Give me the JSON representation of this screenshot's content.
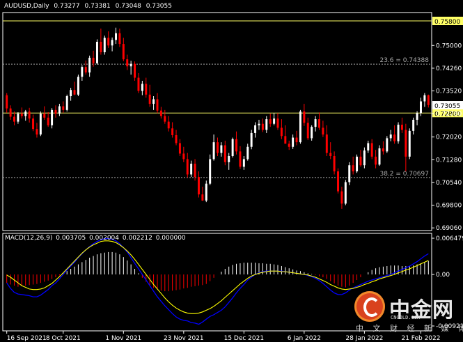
{
  "header": {
    "symbol": "AUDUSD,Daily",
    "open": "0.73277",
    "high": "0.73381",
    "low": "0.73048",
    "close": "0.73055"
  },
  "macd_header": {
    "label": "MACD(12,26,9)",
    "v1": "0.003705",
    "v2": "0.002004",
    "v3": "0.002212",
    "v4": "0.000000"
  },
  "watermark": {
    "brand": "中金网",
    "url": "CNGOLD.COM",
    "tagline": "中 文 财 经 新 媒 体"
  },
  "colors": {
    "background": "#000000",
    "up": "#ffffff",
    "down": "#ff0000",
    "line_level": "#ffff66",
    "fib_level": "#aaaaaa",
    "macd_line": "#0000ff",
    "signal_line": "#ffff00",
    "axis": "#ffffff"
  },
  "chart_data": [
    {
      "type": "candlestick",
      "title": "AUDUSD,Daily",
      "ylim": [
        0.69064,
        0.758
      ],
      "y_ticks": [
        "0.75000",
        "0.74260",
        "0.73520",
        "0.72780",
        "0.72020",
        "0.71280",
        "0.70540",
        "0.69800",
        "0.69060"
      ],
      "x_ticks": [
        "16 Sep 2021",
        "8 Oct 2021",
        "1 Nov 2021",
        "23 Nov 2021",
        "15 Dec 2021",
        "6 Jan 2022",
        "28 Jan 2022",
        "21 Feb 2022"
      ],
      "levels": [
        {
          "value": 0.758,
          "label": "0.75800",
          "kind": "line"
        },
        {
          "value": 0.7439,
          "label": "23.6 = 0.74388",
          "kind": "fib"
        },
        {
          "value": 0.728,
          "label": "0.72800",
          "kind": "line"
        },
        {
          "value": 0.707,
          "label": "38.2 = 0.70697",
          "kind": "fib"
        }
      ],
      "last_price": {
        "value": 0.73055,
        "label": "0.73055"
      },
      "ohlc": [
        [
          0.7338,
          0.7345,
          0.7281,
          0.7295
        ],
        [
          0.7295,
          0.7305,
          0.7258,
          0.7268
        ],
        [
          0.7268,
          0.7285,
          0.724,
          0.7252
        ],
        [
          0.7252,
          0.7283,
          0.7245,
          0.7278
        ],
        [
          0.7278,
          0.7298,
          0.7262,
          0.727
        ],
        [
          0.727,
          0.729,
          0.7255,
          0.7285
        ],
        [
          0.7285,
          0.7297,
          0.7249,
          0.7262
        ],
        [
          0.7262,
          0.7275,
          0.7221,
          0.7228
        ],
        [
          0.7228,
          0.7248,
          0.72,
          0.721
        ],
        [
          0.721,
          0.7285,
          0.7205,
          0.7278
        ],
        [
          0.7278,
          0.7302,
          0.7258,
          0.7265
        ],
        [
          0.7265,
          0.7283,
          0.7235,
          0.724
        ],
        [
          0.724,
          0.7296,
          0.723,
          0.729
        ],
        [
          0.729,
          0.7305,
          0.7265,
          0.7278
        ],
        [
          0.7278,
          0.731,
          0.727,
          0.7302
        ],
        [
          0.7302,
          0.7318,
          0.7281,
          0.729
        ],
        [
          0.729,
          0.734,
          0.7285,
          0.7335
        ],
        [
          0.7335,
          0.7362,
          0.732,
          0.7355
        ],
        [
          0.7355,
          0.7382,
          0.7338,
          0.734
        ],
        [
          0.734,
          0.7405,
          0.7335,
          0.7398
        ],
        [
          0.7398,
          0.7436,
          0.7385,
          0.743
        ],
        [
          0.743,
          0.7451,
          0.7405,
          0.7412
        ],
        [
          0.7412,
          0.7467,
          0.7398,
          0.746
        ],
        [
          0.746,
          0.7483,
          0.7431,
          0.7442
        ],
        [
          0.7442,
          0.752,
          0.7438,
          0.7512
        ],
        [
          0.7512,
          0.7555,
          0.747,
          0.7478
        ],
        [
          0.7478,
          0.7532,
          0.747,
          0.7525
        ],
        [
          0.7525,
          0.7546,
          0.7492,
          0.75
        ],
        [
          0.75,
          0.7526,
          0.7481,
          0.7518
        ],
        [
          0.7518,
          0.7558,
          0.7505,
          0.754
        ],
        [
          0.754,
          0.7555,
          0.7495,
          0.7505
        ],
        [
          0.7505,
          0.7525,
          0.7449,
          0.7455
        ],
        [
          0.7455,
          0.747,
          0.742,
          0.7432
        ],
        [
          0.7432,
          0.745,
          0.7405,
          0.744
        ],
        [
          0.744,
          0.7448,
          0.7385,
          0.7395
        ],
        [
          0.7395,
          0.741,
          0.7345,
          0.7352
        ],
        [
          0.7352,
          0.7385,
          0.7338,
          0.7375
        ],
        [
          0.7375,
          0.7395,
          0.733,
          0.734
        ],
        [
          0.734,
          0.7372,
          0.73,
          0.731
        ],
        [
          0.731,
          0.7335,
          0.729,
          0.7325
        ],
        [
          0.7325,
          0.7345,
          0.728,
          0.7288
        ],
        [
          0.7288,
          0.73,
          0.7262,
          0.727
        ],
        [
          0.727,
          0.729,
          0.7245,
          0.7252
        ],
        [
          0.7252,
          0.727,
          0.722,
          0.723
        ],
        [
          0.723,
          0.725,
          0.72,
          0.7208
        ],
        [
          0.7208,
          0.7225,
          0.7175,
          0.7182
        ],
        [
          0.7182,
          0.7195,
          0.714,
          0.7148
        ],
        [
          0.7148,
          0.717,
          0.712,
          0.713
        ],
        [
          0.713,
          0.715,
          0.707,
          0.708
        ],
        [
          0.708,
          0.7125,
          0.7072,
          0.7115
        ],
        [
          0.7115,
          0.713,
          0.706,
          0.7072
        ],
        [
          0.7072,
          0.709,
          0.7005,
          0.7015
        ],
        [
          0.7015,
          0.704,
          0.6994,
          0.6995
        ],
        [
          0.6995,
          0.706,
          0.699,
          0.705
        ],
        [
          0.705,
          0.7145,
          0.7045,
          0.713
        ],
        [
          0.713,
          0.721,
          0.7125,
          0.7185
        ],
        [
          0.7185,
          0.72,
          0.714,
          0.715
        ],
        [
          0.715,
          0.7185,
          0.7138,
          0.7175
        ],
        [
          0.7175,
          0.719,
          0.711,
          0.712
        ],
        [
          0.712,
          0.715,
          0.7095,
          0.714
        ],
        [
          0.714,
          0.72,
          0.7135,
          0.7195
        ],
        [
          0.7195,
          0.722,
          0.7145,
          0.7155
        ],
        [
          0.7155,
          0.7172,
          0.7098,
          0.7105
        ],
        [
          0.7105,
          0.714,
          0.7095,
          0.713
        ],
        [
          0.713,
          0.718,
          0.7125,
          0.717
        ],
        [
          0.717,
          0.7225,
          0.7162,
          0.7215
        ],
        [
          0.7215,
          0.725,
          0.72,
          0.724
        ],
        [
          0.724,
          0.7258,
          0.7225,
          0.7245
        ],
        [
          0.7245,
          0.7262,
          0.7218,
          0.7225
        ],
        [
          0.7225,
          0.727,
          0.7215,
          0.726
        ],
        [
          0.726,
          0.7278,
          0.7235,
          0.7245
        ],
        [
          0.7245,
          0.728,
          0.724,
          0.7262
        ],
        [
          0.7262,
          0.728,
          0.7225,
          0.7232
        ],
        [
          0.7232,
          0.726,
          0.7195,
          0.7205
        ],
        [
          0.7205,
          0.724,
          0.719,
          0.718
        ],
        [
          0.718,
          0.719,
          0.716,
          0.717
        ],
        [
          0.717,
          0.721,
          0.7163,
          0.72
        ],
        [
          0.72,
          0.7222,
          0.7175,
          0.7185
        ],
        [
          0.7185,
          0.729,
          0.718,
          0.7285
        ],
        [
          0.7285,
          0.731,
          0.7238,
          0.7248
        ],
        [
          0.7248,
          0.7265,
          0.7192,
          0.7198
        ],
        [
          0.7198,
          0.724,
          0.719,
          0.7235
        ],
        [
          0.7235,
          0.727,
          0.722,
          0.726
        ],
        [
          0.726,
          0.7282,
          0.7225,
          0.7232
        ],
        [
          0.7232,
          0.7255,
          0.7202,
          0.721
        ],
        [
          0.721,
          0.724,
          0.714,
          0.715
        ],
        [
          0.715,
          0.7185,
          0.713,
          0.714
        ],
        [
          0.714,
          0.7155,
          0.708,
          0.709
        ],
        [
          0.709,
          0.71,
          0.7018,
          0.7025
        ],
        [
          0.7025,
          0.704,
          0.6968,
          0.6985
        ],
        [
          0.6985,
          0.7062,
          0.698,
          0.7055
        ],
        [
          0.7055,
          0.712,
          0.7045,
          0.711
        ],
        [
          0.711,
          0.7138,
          0.708,
          0.709
        ],
        [
          0.709,
          0.7145,
          0.7085,
          0.7138
        ],
        [
          0.7138,
          0.716,
          0.7105,
          0.711
        ],
        [
          0.711,
          0.7168,
          0.71,
          0.7158
        ],
        [
          0.7158,
          0.719,
          0.715,
          0.7182
        ],
        [
          0.7182,
          0.7195,
          0.713,
          0.7138
        ],
        [
          0.7138,
          0.716,
          0.71,
          0.7112
        ],
        [
          0.7112,
          0.7175,
          0.7108,
          0.7165
        ],
        [
          0.7165,
          0.7188,
          0.7145,
          0.7155
        ],
        [
          0.7155,
          0.7205,
          0.715,
          0.7198
        ],
        [
          0.7198,
          0.7225,
          0.7188,
          0.721
        ],
        [
          0.721,
          0.724,
          0.718,
          0.7188
        ],
        [
          0.7188,
          0.725,
          0.718,
          0.7242
        ],
        [
          0.7242,
          0.7265,
          0.7215,
          0.7225
        ],
        [
          0.7225,
          0.7245,
          0.709,
          0.7138
        ],
        [
          0.7138,
          0.723,
          0.713,
          0.7222
        ],
        [
          0.7222,
          0.7265,
          0.721,
          0.7258
        ],
        [
          0.7258,
          0.7286,
          0.724,
          0.728
        ],
        [
          0.728,
          0.733,
          0.727,
          0.7318
        ],
        [
          0.7318,
          0.7345,
          0.73,
          0.7338
        ],
        [
          0.7338,
          0.734,
          0.7298,
          0.7306
        ]
      ]
    },
    {
      "type": "macd",
      "title": "MACD(12,26,9)",
      "ylim": [
        -0.009215,
        0.006479
      ],
      "y_ticks": [
        "0.006479",
        "0.00",
        "-0.009215"
      ],
      "histogram": [
        -0.0015,
        -0.0018,
        -0.002,
        -0.0022,
        -0.0021,
        -0.002,
        -0.0019,
        -0.0018,
        -0.0017,
        -0.0015,
        -0.0013,
        -0.0011,
        -0.0008,
        -0.0005,
        -0.0002,
        0.0002,
        0.0006,
        0.001,
        0.0014,
        0.0018,
        0.0022,
        0.0026,
        0.003,
        0.0033,
        0.0036,
        0.0038,
        0.0039,
        0.004,
        0.004,
        0.0039,
        0.0036,
        0.0031,
        0.0025,
        0.0018,
        0.001,
        0.0002,
        -0.0006,
        -0.0013,
        -0.0019,
        -0.0024,
        -0.0027,
        -0.0029,
        -0.003,
        -0.003,
        -0.0029,
        -0.0028,
        -0.0027,
        -0.0025,
        -0.0024,
        -0.0022,
        -0.0021,
        -0.002,
        -0.0019,
        -0.0017,
        -0.0012,
        -0.0006,
        0.0,
        0.0005,
        0.001,
        0.0014,
        0.0017,
        0.0019,
        0.002,
        0.0021,
        0.0021,
        0.0021,
        0.0021,
        0.002,
        0.002,
        0.0019,
        0.0019,
        0.0018,
        0.0017,
        0.0015,
        0.0013,
        0.0011,
        0.0009,
        0.0007,
        0.0006,
        0.0004,
        0.0002,
        0.0001,
        -0.0001,
        -0.0003,
        -0.0005,
        -0.0008,
        -0.0012,
        -0.0016,
        -0.002,
        -0.0022,
        -0.0023,
        -0.002,
        -0.0015,
        -0.001,
        -0.0005,
        0.0,
        0.0004,
        0.0008,
        0.0011,
        0.0013,
        0.0014,
        0.0015,
        0.0016,
        0.0016,
        0.0016,
        0.0015,
        0.0015,
        0.0015,
        0.0016,
        0.0018,
        0.002,
        0.0022,
        0.0024
      ],
      "macd": [
        -0.0015,
        -0.0025,
        -0.0032,
        -0.0035,
        -0.0036,
        -0.0037,
        -0.0038,
        -0.004,
        -0.004,
        -0.0037,
        -0.0032,
        -0.0027,
        -0.002,
        -0.0015,
        -0.0008,
        0.0,
        0.0008,
        0.0015,
        0.0022,
        0.003,
        0.0037,
        0.0044,
        0.005,
        0.0055,
        0.0059,
        0.0062,
        0.0064,
        0.0064,
        0.0063,
        0.006,
        0.0055,
        0.0048,
        0.004,
        0.003,
        0.002,
        0.001,
        0.0,
        -0.001,
        -0.002,
        -0.003,
        -0.004,
        -0.0048,
        -0.0056,
        -0.0063,
        -0.007,
        -0.0076,
        -0.008,
        -0.0082,
        -0.0083,
        -0.0086,
        -0.0087,
        -0.0089,
        -0.0085,
        -0.008,
        -0.0075,
        -0.0072,
        -0.0068,
        -0.0064,
        -0.0058,
        -0.005,
        -0.0042,
        -0.0033,
        -0.0025,
        -0.0018,
        -0.001,
        -0.0005,
        0.0,
        0.0003,
        0.0005,
        0.0006,
        0.0006,
        0.0006,
        0.0006,
        0.0006,
        0.0005,
        0.0004,
        0.0003,
        0.0002,
        0.0001,
        0.0,
        -0.0002,
        -0.0004,
        -0.0007,
        -0.0011,
        -0.0016,
        -0.0022,
        -0.0028,
        -0.0033,
        -0.0036,
        -0.0036,
        -0.0033,
        -0.0028,
        -0.0024,
        -0.0021,
        -0.0018,
        -0.0015,
        -0.0012,
        -0.001,
        -0.0008,
        -0.0006,
        -0.0004,
        -0.0002,
        0.0,
        0.0003,
        0.0006,
        0.0009,
        0.0012,
        0.0015,
        0.0019,
        0.0023,
        0.0028,
        0.0033,
        0.0037
      ],
      "signal": [
        -0.0001,
        -0.0005,
        -0.001,
        -0.0015,
        -0.002,
        -0.0023,
        -0.0026,
        -0.0027,
        -0.0027,
        -0.0026,
        -0.0024,
        -0.002,
        -0.0016,
        -0.001,
        -0.0004,
        0.0003,
        0.001,
        0.0017,
        0.0024,
        0.0031,
        0.0038,
        0.0044,
        0.0049,
        0.0053,
        0.0056,
        0.0059,
        0.006,
        0.006,
        0.0059,
        0.0057,
        0.0053,
        0.0048,
        0.0042,
        0.0035,
        0.0027,
        0.0018,
        0.0009,
        0.0,
        -0.0009,
        -0.0018,
        -0.0026,
        -0.0034,
        -0.0042,
        -0.0049,
        -0.0055,
        -0.006,
        -0.0064,
        -0.0067,
        -0.0069,
        -0.007,
        -0.007,
        -0.0069,
        -0.0067,
        -0.0064,
        -0.0061,
        -0.0057,
        -0.0052,
        -0.0047,
        -0.0041,
        -0.0035,
        -0.0029,
        -0.0023,
        -0.0017,
        -0.0012,
        -0.0007,
        -0.0003,
        0.0,
        0.0002,
        0.0004,
        0.0005,
        0.0006,
        0.0006,
        0.0006,
        0.0005,
        0.0005,
        0.0004,
        0.0003,
        0.0002,
        0.0001,
        0.0,
        -0.0001,
        -0.0003,
        -0.0005,
        -0.0008,
        -0.0011,
        -0.0014,
        -0.0018,
        -0.0021,
        -0.0024,
        -0.0026,
        -0.0027,
        -0.0026,
        -0.0025,
        -0.0023,
        -0.0021,
        -0.0018,
        -0.0016,
        -0.0013,
        -0.0011,
        -0.0008,
        -0.0006,
        -0.0004,
        -0.0002,
        0.0,
        0.0003,
        0.0005,
        0.0008,
        0.001,
        0.0013,
        0.0016,
        0.0019,
        0.0022,
        0.0025
      ]
    }
  ]
}
